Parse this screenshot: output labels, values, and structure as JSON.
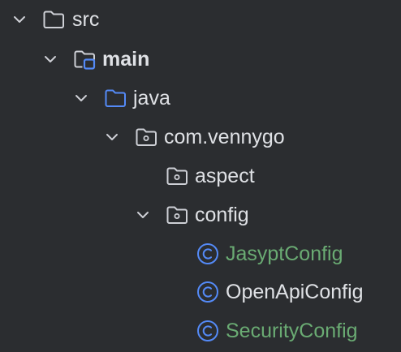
{
  "project_tree": {
    "nodes": [
      {
        "label": "src",
        "icon": "folder-icon",
        "expanded": true
      },
      {
        "label": "main",
        "icon": "source-folder-icon",
        "expanded": true
      },
      {
        "label": "java",
        "icon": "source-root-folder-icon",
        "expanded": true
      },
      {
        "label": "com.vennygo",
        "icon": "package-icon",
        "expanded": true
      },
      {
        "label": "aspect",
        "icon": "package-icon",
        "expanded": false
      },
      {
        "label": "config",
        "icon": "package-icon",
        "expanded": true
      },
      {
        "label": "JasyptConfig",
        "icon": "class-icon",
        "vcs_status": "added"
      },
      {
        "label": "OpenApiConfig",
        "icon": "class-icon",
        "vcs_status": "unchanged"
      },
      {
        "label": "SecurityConfig",
        "icon": "class-icon",
        "vcs_status": "added"
      }
    ]
  },
  "colors": {
    "background": "#2b2d30",
    "text": "#dfe1e5",
    "added_text": "#6aab73",
    "folder_stroke": "#ced0d6",
    "source_folder_accent": "#548af7",
    "class_icon": "#548af7"
  }
}
